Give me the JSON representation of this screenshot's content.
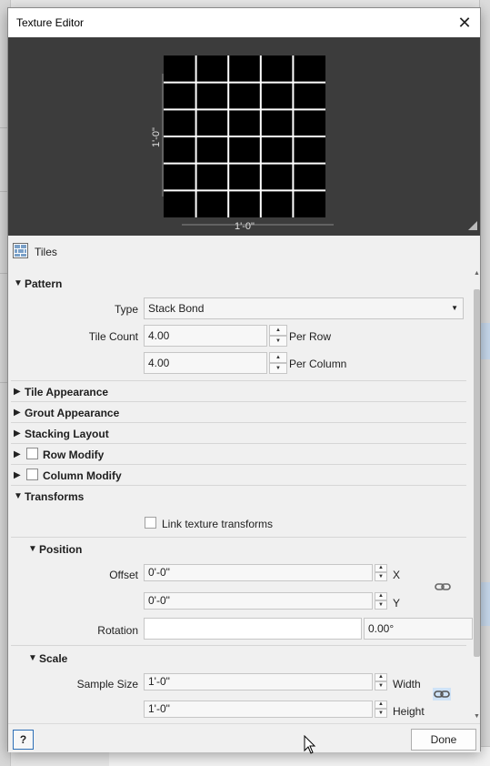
{
  "dialog": {
    "title": "Texture Editor",
    "close_label": "✕"
  },
  "preview": {
    "height_label": "1'-0\"",
    "width_label": "1'-0\"",
    "grid_rows": 6,
    "grid_cols": 5
  },
  "tiles_header": {
    "label": "Tiles"
  },
  "pattern": {
    "title": "Pattern",
    "type_label": "Type",
    "type_value": "Stack Bond",
    "tile_count_label": "Tile Count",
    "per_row_value": "4.00",
    "per_row_unit": "Per Row",
    "per_column_value": "4.00",
    "per_column_unit": "Per Column"
  },
  "sections": {
    "tile_appearance": "Tile Appearance",
    "grout_appearance": "Grout Appearance",
    "stacking_layout": "Stacking Layout",
    "row_modify": "Row Modify",
    "column_modify": "Column Modify",
    "transforms": "Transforms"
  },
  "transforms": {
    "link_label": "Link texture transforms",
    "position_title": "Position",
    "offset_label": "Offset",
    "offset_x": "0'-0\"",
    "offset_x_unit": "X",
    "offset_y": "0'-0\"",
    "offset_y_unit": "Y",
    "rotation_label": "Rotation",
    "rotation_value": "",
    "rotation_degrees": "0.00°",
    "scale_title": "Scale",
    "sample_size_label": "Sample Size",
    "width_value": "1'-0\"",
    "width_unit": "Width",
    "height_value": "1'-0\"",
    "height_unit": "Height"
  },
  "footer": {
    "help_label": "?",
    "done_label": "Done"
  },
  "colors": {
    "preview_bg": "#3c3c3c",
    "tile": "#000000",
    "grout": "#ffffff",
    "link_active": "#cfe3f7"
  }
}
